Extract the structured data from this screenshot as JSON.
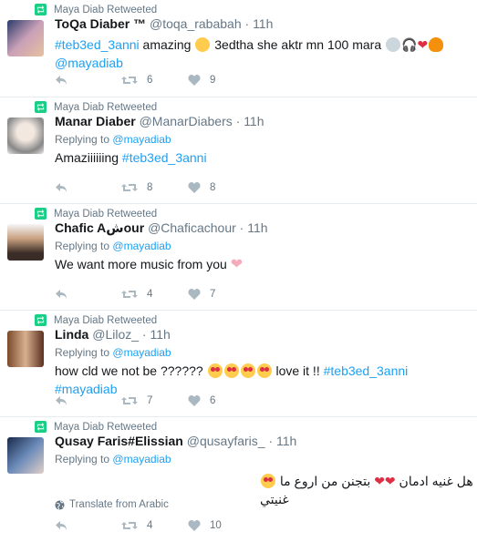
{
  "retweet_context": "Maya Diab Retweeted",
  "tweets": [
    {
      "name": "ToQa Diaber ™",
      "handle": "@toqa_rababah",
      "time": "11h",
      "replying_to": "",
      "text_parts": [
        "#teb3ed_3anni",
        " amazing ",
        " 3edtha she aktr mn 100 mara ",
        "@mayadiab"
      ],
      "replies": "",
      "retweets": "6",
      "likes": "9"
    },
    {
      "name": "Manar Diaber",
      "handle": "@ManarDiabers",
      "time": "11h",
      "replying_label": "Replying to",
      "replying_to": "@mayadiab",
      "text_parts": [
        "Amaziiiiiing ",
        "#teb3ed_3anni"
      ],
      "replies": "",
      "retweets": "8",
      "likes": "8"
    },
    {
      "name": "Chafic Aشour",
      "handle": "@Chaficachour",
      "time": "11h",
      "replying_label": "Replying to",
      "replying_to": "@mayadiab",
      "text_parts": [
        "We want more music from you "
      ],
      "replies": "",
      "retweets": "4",
      "likes": "7"
    },
    {
      "name": "Linda",
      "handle": "@Liloz_",
      "time": "11h",
      "replying_label": "Replying to",
      "replying_to": "@mayadiab",
      "text_parts": [
        "how cld we not be ?????? ",
        " love it !! ",
        "#teb3ed_3anni",
        "#mayadiab"
      ],
      "replies": "",
      "retweets": "7",
      "likes": "6"
    },
    {
      "name": "Qusay Faris#Elissian",
      "handle": "@qusayfaris_",
      "time": "11h",
      "replying_label": "Replying to",
      "replying_to": "@mayadiab",
      "text_parts": [
        "بتجنن من اروع ما غنيتي",
        "هل غنيه ادمان"
      ],
      "translate": "Translate from Arabic",
      "replies": "",
      "retweets": "4",
      "likes": "10"
    }
  ],
  "colors": {
    "accent": "#1da1f2",
    "retweet_green": "#19cf86",
    "muted": "#657786",
    "icon": "#aab8c2",
    "heart": "#e0245e"
  }
}
